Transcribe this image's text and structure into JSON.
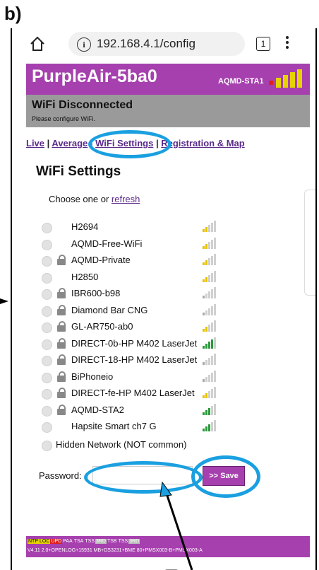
{
  "figure_label": "b)",
  "browser": {
    "url": "192.168.4.1/config",
    "tab_count": "1"
  },
  "header": {
    "title": "PurpleAir-5ba0",
    "ssid": "AQMD-STA1"
  },
  "status": {
    "title": "WiFi Disconnected",
    "subtitle": "Please configure WiFi."
  },
  "nav": {
    "live": "Live",
    "sep1": "|",
    "average": "Average",
    "sep2": "|",
    "wifi": "WiFi Settings",
    "sep3": "|",
    "registration": "Registration & Map"
  },
  "page_title": "WiFi Settings",
  "choose": {
    "text": "Choose one or",
    "link": "refresh"
  },
  "networks": [
    {
      "ssid": "H2694",
      "locked": false,
      "strength": 2,
      "color": "#e6c200"
    },
    {
      "ssid": "AQMD-Free-WiFi",
      "locked": false,
      "strength": 2,
      "color": "#e6c200"
    },
    {
      "ssid": "AQMD-Private",
      "locked": true,
      "strength": 2,
      "color": "#e6c200"
    },
    {
      "ssid": "H2850",
      "locked": false,
      "strength": 2,
      "color": "#e6c200"
    },
    {
      "ssid": "IBR600-b98",
      "locked": true,
      "strength": 1,
      "color": "#aaaaaa"
    },
    {
      "ssid": "Diamond Bar CNG",
      "locked": true,
      "strength": 1,
      "color": "#aaaaaa"
    },
    {
      "ssid": "GL-AR750-ab0",
      "locked": true,
      "strength": 2,
      "color": "#e6c200"
    },
    {
      "ssid": "DIRECT-0b-HP M402 LaserJet",
      "locked": true,
      "strength": 4,
      "color": "#2a9a3a"
    },
    {
      "ssid": "DIRECT-18-HP M402 LaserJet",
      "locked": true,
      "strength": 1,
      "color": "#aaaaaa"
    },
    {
      "ssid": "BiPhoneio",
      "locked": true,
      "strength": 1,
      "color": "#aaaaaa"
    },
    {
      "ssid": "DIRECT-fe-HP M402 LaserJet",
      "locked": true,
      "strength": 2,
      "color": "#e6c200"
    },
    {
      "ssid": "AQMD-STA2",
      "locked": true,
      "strength": 3,
      "color": "#2a9a3a"
    },
    {
      "ssid": "Hapsite Smart ch7 G",
      "locked": false,
      "strength": 3,
      "color": "#2a9a3a"
    }
  ],
  "hidden_network": "Hidden Network (NOT common)",
  "password": {
    "label": "Password:",
    "value": ""
  },
  "save_label": ">> Save",
  "footer": {
    "badges": [
      {
        "text": "NTP",
        "style": "fb-yellow"
      },
      {
        "text": "LOC",
        "style": "fb-yellow"
      },
      {
        "text": "UPD",
        "style": "fb-red"
      },
      {
        "text": "PAA",
        "style": "fb-plain"
      },
      {
        "text": "TSA",
        "style": "fb-plain"
      },
      {
        "text": "TSS",
        "style": "fb-plain"
      },
      {
        "text": "3RD",
        "style": "fb-gray"
      },
      {
        "text": "TSB",
        "style": "fb-plain"
      },
      {
        "text": "TSS",
        "style": "fb-plain"
      },
      {
        "text": "3RD",
        "style": "fb-gray"
      }
    ],
    "version": "V4.11 2.0+OPENLOG+15931 MB+DS3231+BME 80+PMSX003-B+PMSX003-A"
  },
  "colors": {
    "accent": "#a640ae",
    "status_bg": "#9a9a9a",
    "annotation": "#1aa0e0"
  }
}
